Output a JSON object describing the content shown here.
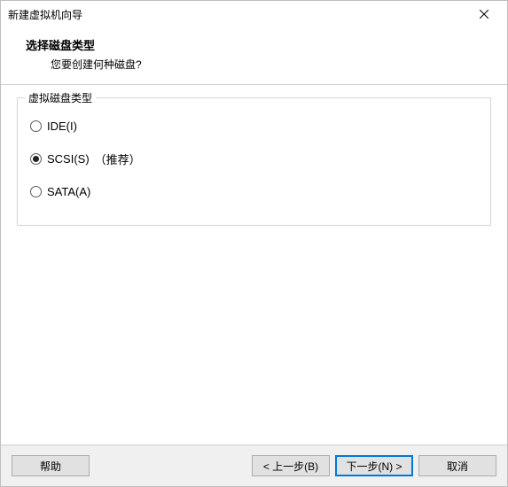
{
  "window": {
    "title": "新建虚拟机向导"
  },
  "header": {
    "title": "选择磁盘类型",
    "subtitle": "您要创建何种磁盘?"
  },
  "group": {
    "legend": "虚拟磁盘类型",
    "options": [
      {
        "label": "IDE(I)",
        "hint": "",
        "selected": false
      },
      {
        "label": "SCSI(S)",
        "hint": "（推荐）",
        "selected": true
      },
      {
        "label": "SATA(A)",
        "hint": "",
        "selected": false
      }
    ]
  },
  "buttons": {
    "help": "帮助",
    "back": "< 上一步(B)",
    "next": "下一步(N) >",
    "cancel": "取消"
  }
}
